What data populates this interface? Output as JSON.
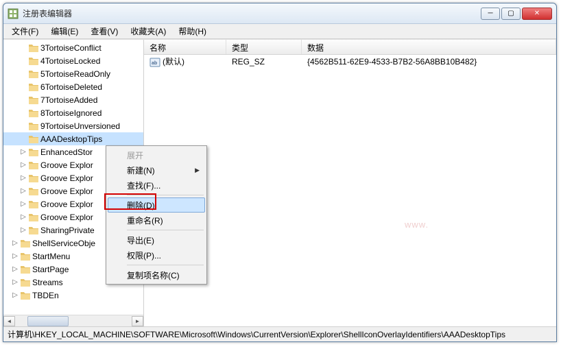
{
  "window": {
    "title": "注册表编辑器"
  },
  "menubar": {
    "items": [
      "文件(F)",
      "编辑(E)",
      "查看(V)",
      "收藏夹(A)",
      "帮助(H)"
    ]
  },
  "tree": {
    "items": [
      {
        "label": "3TortoiseConflict",
        "indent": 2,
        "expandable": false
      },
      {
        "label": "4TortoiseLocked",
        "indent": 2,
        "expandable": false
      },
      {
        "label": "5TortoiseReadOnly",
        "indent": 2,
        "expandable": false
      },
      {
        "label": "6TortoiseDeleted",
        "indent": 2,
        "expandable": false
      },
      {
        "label": "7TortoiseAdded",
        "indent": 2,
        "expandable": false
      },
      {
        "label": "8TortoiseIgnored",
        "indent": 2,
        "expandable": false
      },
      {
        "label": "9TortoiseUnversioned",
        "indent": 2,
        "expandable": false
      },
      {
        "label": "AAADesktopTips",
        "indent": 2,
        "expandable": false,
        "selected": true
      },
      {
        "label": "EnhancedStor",
        "indent": 2,
        "expandable": true
      },
      {
        "label": "Groove Explor",
        "indent": 2,
        "expandable": true
      },
      {
        "label": "Groove Explor",
        "indent": 2,
        "expandable": true
      },
      {
        "label": "Groove Explor",
        "indent": 2,
        "expandable": true
      },
      {
        "label": "Groove Explor",
        "indent": 2,
        "expandable": true
      },
      {
        "label": "Groove Explor",
        "indent": 2,
        "expandable": true
      },
      {
        "label": "SharingPrivate",
        "indent": 2,
        "expandable": true
      },
      {
        "label": "ShellServiceObje",
        "indent": 1,
        "expandable": true
      },
      {
        "label": "StartMenu",
        "indent": 1,
        "expandable": true
      },
      {
        "label": "StartPage",
        "indent": 1,
        "expandable": true
      },
      {
        "label": "Streams",
        "indent": 1,
        "expandable": true
      },
      {
        "label": "TBDEn",
        "indent": 1,
        "expandable": true
      }
    ]
  },
  "list": {
    "columns": {
      "name": "名称",
      "type": "类型",
      "data": "数据"
    },
    "rows": [
      {
        "name": "(默认)",
        "type": "REG_SZ",
        "data": "{4562B511-62E9-4533-B7B2-56A8BB10B482}"
      }
    ]
  },
  "context_menu": {
    "expand": "展开",
    "new": "新建(N)",
    "find": "查找(F)...",
    "delete": "删除(D)",
    "rename": "重命名(R)",
    "export": "导出(E)",
    "permissions": "权限(P)...",
    "copy_key_name": "复制项名称(C)"
  },
  "watermark": "www.",
  "statusbar": {
    "path": "计算机\\HKEY_LOCAL_MACHINE\\SOFTWARE\\Microsoft\\Windows\\CurrentVersion\\Explorer\\ShellIconOverlayIdentifiers\\AAADesktopTips"
  }
}
